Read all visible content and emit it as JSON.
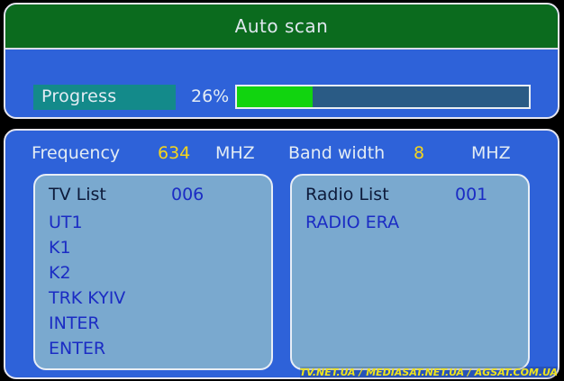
{
  "title": "Auto scan",
  "progress": {
    "label": "Progress",
    "percent_text": "26%",
    "fraction": 0.26
  },
  "signal": {
    "frequency_label": "Frequency",
    "frequency_value": "634",
    "frequency_unit": "MHZ",
    "bandwidth_label": "Band width",
    "bandwidth_value": "8",
    "bandwidth_unit": "MHZ"
  },
  "tv_list": {
    "label": "TV List",
    "count": "006",
    "channels": [
      "UT1",
      "K1",
      "K2",
      "TRK KYIV",
      "INTER",
      "ENTER"
    ]
  },
  "radio_list": {
    "label": "Radio List",
    "count": "001",
    "channels": [
      "RADIO ERA"
    ]
  },
  "watermark": "TV.NET.UA / MEDIASAT.NET.UA / AGSAT.COM.UA",
  "colors": {
    "title_bar": "#0b6b1e",
    "panel": "#2e62d9",
    "list_box": "#7aa9cf",
    "progress_fill": "#11d40f",
    "progress_track": "#2a5b85",
    "value_highlight": "#f5d51c"
  }
}
